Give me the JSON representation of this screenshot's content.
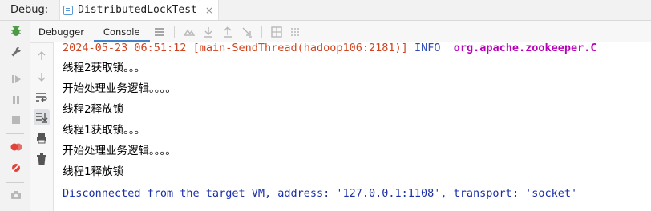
{
  "titlebar": {
    "debug_label": "Debug:",
    "run_tab_title": "DistributedLockTest",
    "close_glyph": "×"
  },
  "tabs": {
    "debugger": "Debugger",
    "console": "Console"
  },
  "console": {
    "log_line": {
      "timestamp": "2024-05-23 06:51:12",
      "thread": "[main-SendThread(hadoop106:2181)]",
      "level": "INFO",
      "logger": "org.apache.zookeeper.C"
    },
    "lines": [
      "线程2获取锁。。。",
      "开始处理业务逻辑。。。。",
      "线程2释放锁",
      "线程1获取锁。。。",
      "开始处理业务逻辑。。。。",
      "线程1释放锁"
    ],
    "disconnected": "Disconnected from the target VM, address: '127.0.0.1:1108', transport: 'socket'"
  },
  "colors": {
    "timestamp": "#d0431e",
    "info": "#2e49b5",
    "logger": "#b800b8",
    "disconnected": "#1a2fa8",
    "accent": "#4083c9"
  }
}
